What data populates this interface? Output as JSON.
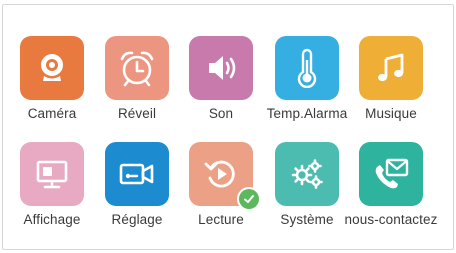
{
  "menu": {
    "items": [
      {
        "key": "camera",
        "label": "Caméra",
        "icon": "webcam-icon",
        "color": "#e8793f"
      },
      {
        "key": "reveil",
        "label": "Réveil",
        "icon": "alarm-clock-icon",
        "color": "#ec9580"
      },
      {
        "key": "son",
        "label": "Son",
        "icon": "speaker-icon",
        "color": "#c77aab"
      },
      {
        "key": "temp-alarma",
        "label": "Temp.Alarma",
        "icon": "thermometer-icon",
        "color": "#35aee2"
      },
      {
        "key": "musique",
        "label": "Musique",
        "icon": "music-note-icon",
        "color": "#efae36"
      },
      {
        "key": "affichage",
        "label": "Affichage",
        "icon": "monitor-icon",
        "color": "#e8a9c3"
      },
      {
        "key": "reglage",
        "label": "Réglage",
        "icon": "video-camera-icon",
        "color": "#1d8bd0"
      },
      {
        "key": "lecture",
        "label": "Lecture",
        "icon": "replay-icon",
        "color": "#eca186",
        "badge": {
          "icon": "checkmark-icon",
          "color": "#5cb85c"
        }
      },
      {
        "key": "systeme",
        "label": "Système",
        "icon": "gears-icon",
        "color": "#4dbcb0"
      },
      {
        "key": "nous-contactez",
        "label": "nous-contactez",
        "icon": "phone-mail-icon",
        "color": "#2eb39f"
      }
    ]
  }
}
